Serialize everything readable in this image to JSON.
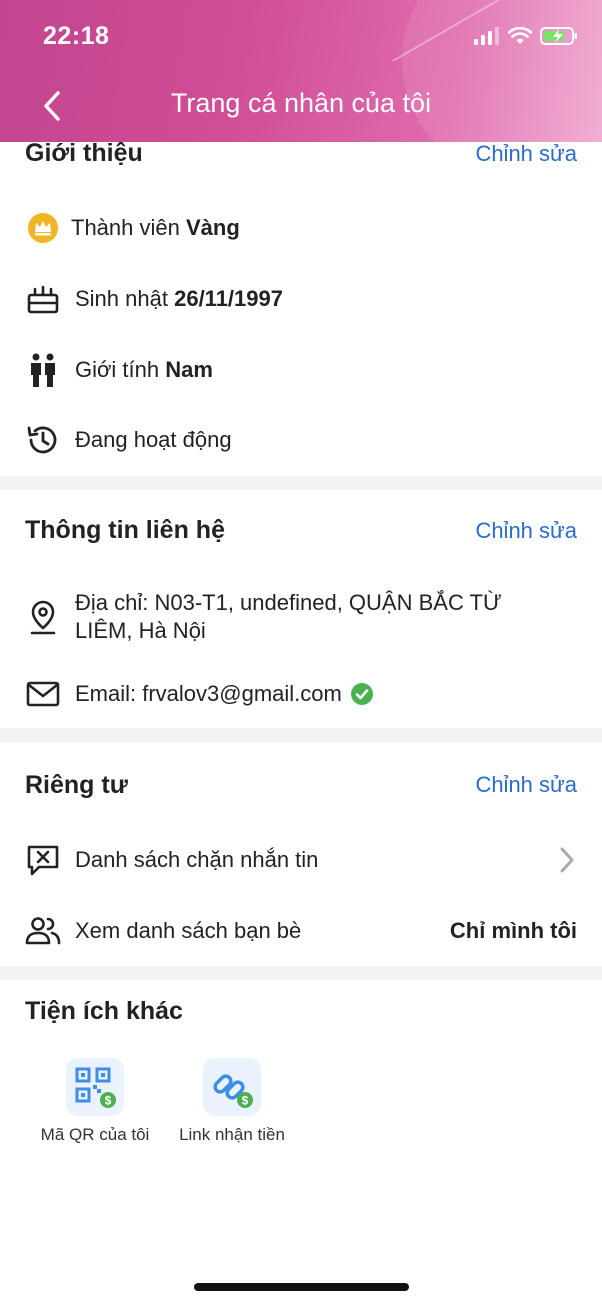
{
  "status_bar": {
    "time": "22:18"
  },
  "header": {
    "title": "Trang cá nhân của tôi"
  },
  "intro": {
    "title": "Giới thiệu",
    "edit_label": "Chỉnh sửa",
    "membership_prefix": "Thành viên",
    "membership_value": "Vàng",
    "birthday_prefix": "Sinh nhật",
    "birthday_value": "26/11/1997",
    "gender_prefix": "Giới tính",
    "gender_value": "Nam",
    "activity": "Đang hoạt động"
  },
  "contact": {
    "title": "Thông tin liên hệ",
    "edit_label": "Chỉnh sửa",
    "address": "Địa chỉ: N03-T1, undefined, QUẬN BẮC TỪ LIÊM, Hà Nội",
    "email": "Email: frvalov3@gmail.com"
  },
  "privacy": {
    "title": "Riêng tư",
    "edit_label": "Chỉnh sửa",
    "block_list": "Danh sách chặn nhắn tin",
    "friends_list": "Xem danh sách bạn bè",
    "friends_list_value": "Chỉ mình tôi"
  },
  "utilities": {
    "title": "Tiện ích khác",
    "items": [
      {
        "label": "Mã QR của tôi",
        "icon": "qr-code-icon"
      },
      {
        "label": "Link nhận tiền",
        "icon": "link-icon"
      }
    ]
  },
  "colors": {
    "accent": "#2a6bd0",
    "header": "#c94b92",
    "verified": "#4cb050",
    "gold": "#f0b429"
  }
}
